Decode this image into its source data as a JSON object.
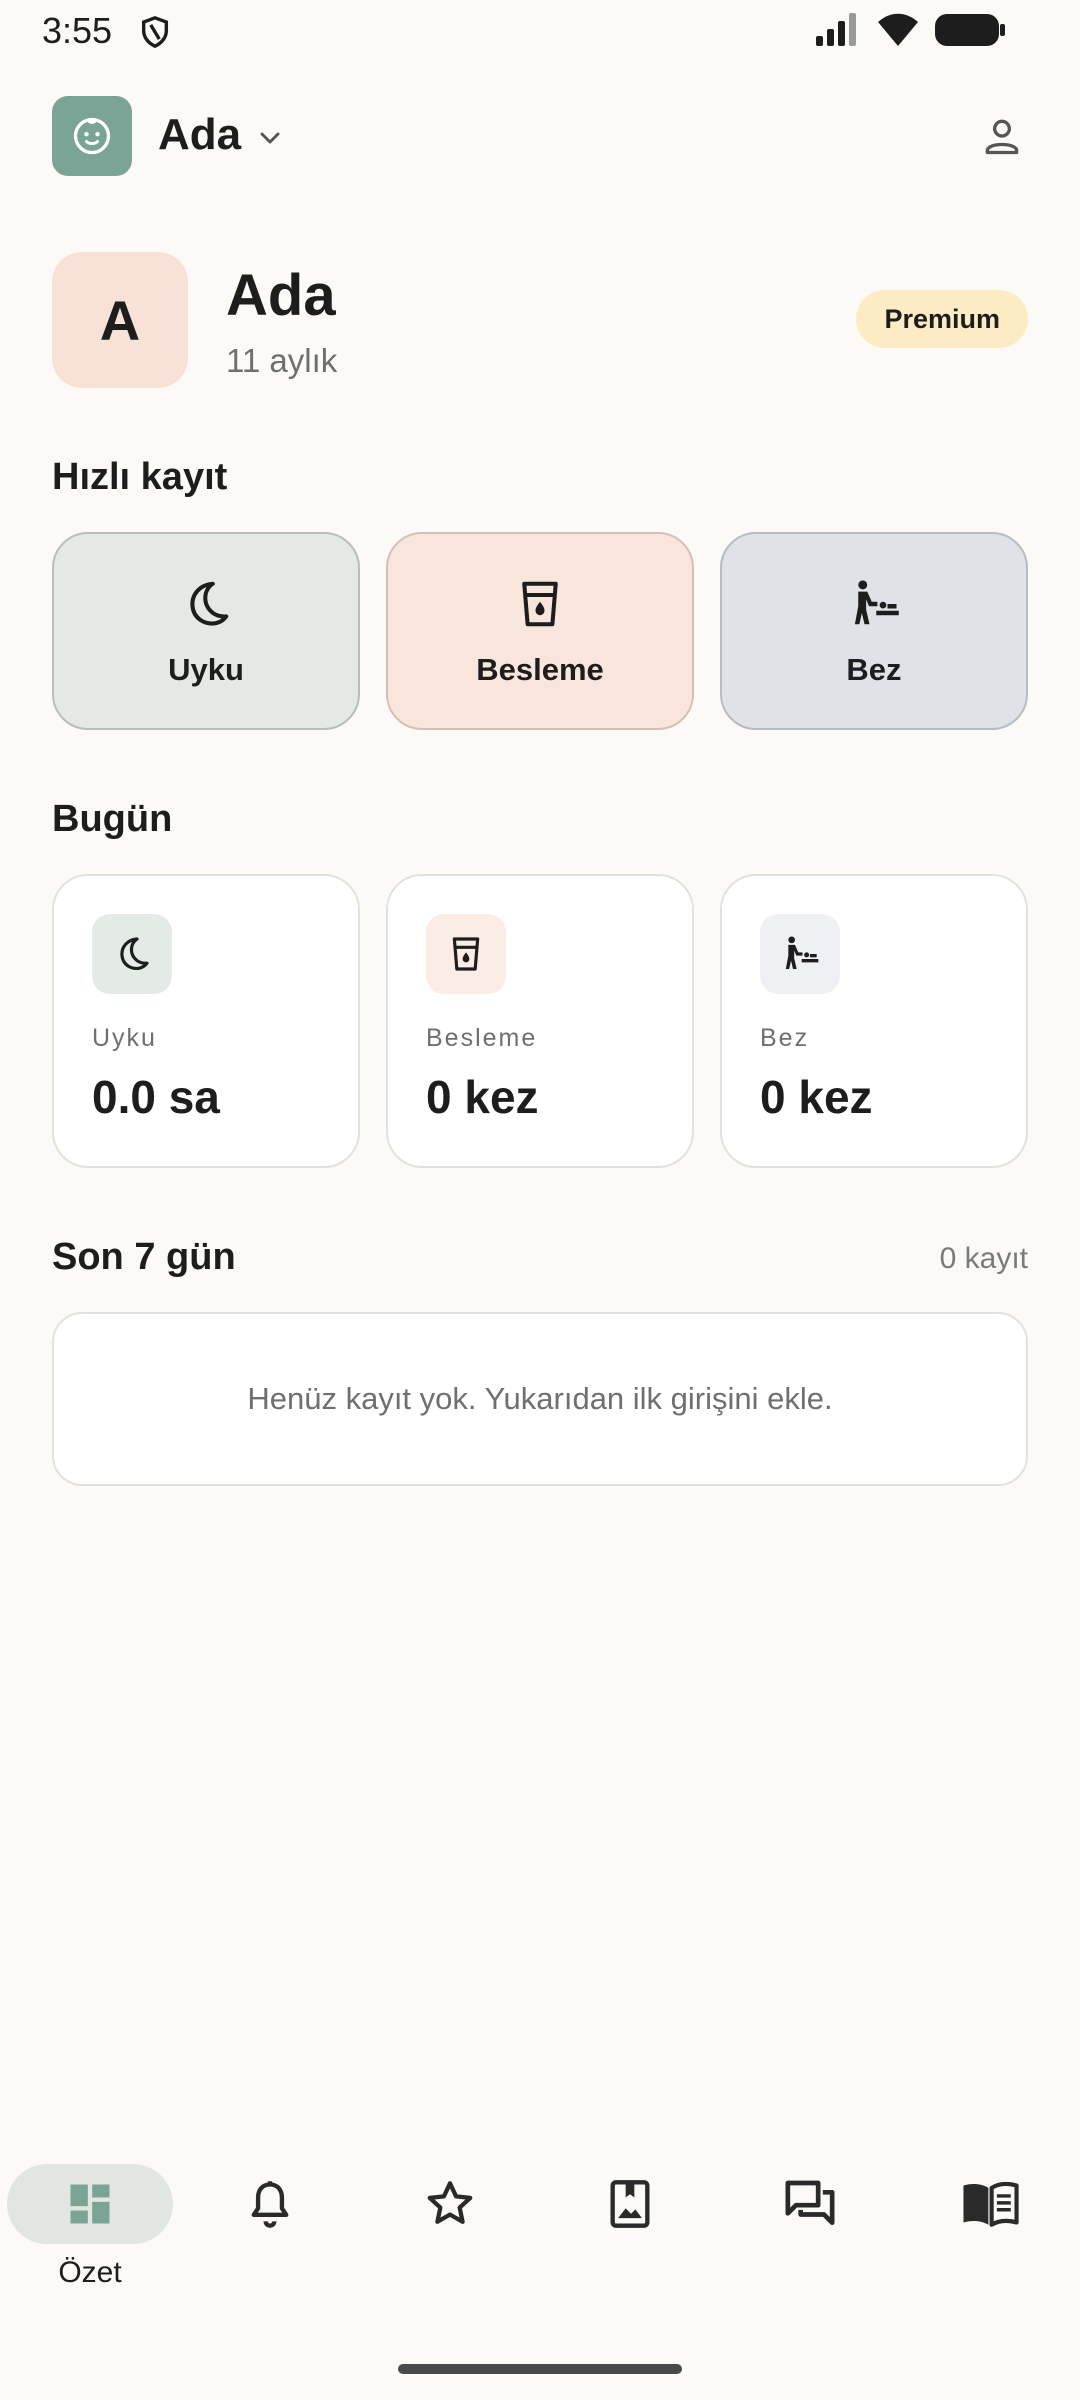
{
  "status_bar": {
    "time": "3:55"
  },
  "top_bar": {
    "profile_name": "Ada"
  },
  "child": {
    "initial": "A",
    "name": "Ada",
    "age": "11 aylık",
    "badge": "Premium"
  },
  "quick_log": {
    "title": "Hızlı kayıt",
    "items": [
      {
        "label": "Uyku",
        "icon": "moon-icon",
        "bg": "#e4e9e3",
        "border": "#b9beb8"
      },
      {
        "label": "Besleme",
        "icon": "cup-icon",
        "bg": "#f8e6dc",
        "border": "#d6bfb4"
      },
      {
        "label": "Bez",
        "icon": "baby-changing-icon",
        "bg": "#dfe3e8",
        "border": "#b8bcc1"
      }
    ]
  },
  "today": {
    "title": "Bugün",
    "stats": [
      {
        "label": "Uyku",
        "value": "0.0 sa",
        "icon": "moon-icon",
        "icon_bg": "#e4ebe6"
      },
      {
        "label": "Besleme",
        "value": "0 kez",
        "icon": "cup-icon",
        "icon_bg": "#fbede6"
      },
      {
        "label": "Bez",
        "value": "0 kez",
        "icon": "baby-changing-icon",
        "icon_bg": "#eef0f3"
      }
    ]
  },
  "last7": {
    "title": "Son 7 gün",
    "count": "0 kayıt",
    "empty_text": "Henüz kayıt yok. Yukarıdan ilk girişini ekle."
  },
  "bottom_nav": {
    "items": [
      {
        "label": "Özet",
        "icon": "dashboard-icon",
        "active": true
      },
      {
        "label": "",
        "icon": "bell-icon",
        "active": false
      },
      {
        "label": "",
        "icon": "star-icon",
        "active": false
      },
      {
        "label": "",
        "icon": "photo-album-icon",
        "active": false
      },
      {
        "label": "",
        "icon": "chat-icon",
        "active": false
      },
      {
        "label": "",
        "icon": "book-icon",
        "active": false
      }
    ]
  },
  "colors": {
    "background": "#fbfaf7",
    "accent": "#7aa596",
    "premium": "#fbecc3"
  }
}
